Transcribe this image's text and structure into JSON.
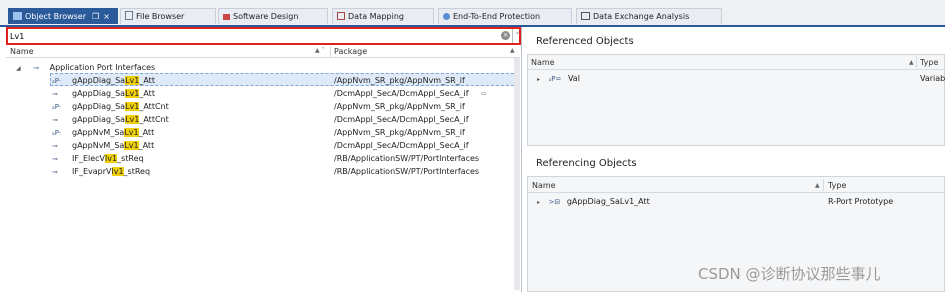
{
  "tabs": [
    {
      "label": "Object Browser",
      "active": true,
      "icon": "object-browser-icon"
    },
    {
      "label": "File Browser",
      "active": false,
      "icon": "file-icon"
    },
    {
      "label": "Software Design",
      "active": false,
      "icon": "software-design-icon"
    },
    {
      "label": "Data Mapping",
      "active": false,
      "icon": "data-mapping-icon"
    },
    {
      "label": "End-To-End Protection",
      "active": false,
      "icon": "protection-icon"
    },
    {
      "label": "Data Exchange Analysis",
      "active": false,
      "icon": "analysis-icon"
    }
  ],
  "tab_controls": {
    "pin": "❒",
    "close": "×"
  },
  "search": {
    "value": "Lv1",
    "clear": "×",
    "dropdown": "˅"
  },
  "left": {
    "col_name": "Name",
    "col_package": "Package",
    "root": "Application Port Interfaces",
    "rows": [
      {
        "pre": "gAppDiag_Sa",
        "hl": "Lv1",
        "post": "_Att",
        "package": "/AppNvm_SR_pkg/AppNvm_SR_if",
        "selected": true
      },
      {
        "pre": "gAppDiag_Sa",
        "hl": "Lv1",
        "post": "_Att",
        "package": "/DcmAppl_SecA/DcmAppl_SecA_if",
        "selected": false
      },
      {
        "pre": "gAppDiag_Sa",
        "hl": "Lv1",
        "post": "_AttCnt",
        "package": "/AppNvm_SR_pkg/AppNvm_SR_if",
        "selected": false
      },
      {
        "pre": "gAppDiag_Sa",
        "hl": "Lv1",
        "post": "_AttCnt",
        "package": "/DcmAppl_SecA/DcmAppl_SecA_if",
        "selected": false
      },
      {
        "pre": "gAppNvM_Sa",
        "hl": "Lv1",
        "post": "_Att",
        "package": "/AppNvm_SR_pkg/AppNvm_SR_if",
        "selected": false
      },
      {
        "pre": "gAppNvM_Sa",
        "hl": "Lv1",
        "post": "_Att",
        "package": "/DcmAppl_SecA/DcmAppl_SecA_if",
        "selected": false
      },
      {
        "pre": "IF_ElecV",
        "hl": "lv1",
        "post": "_stReq",
        "package": "/RB/ApplicationSW/PT/PortInterfaces",
        "selected": false
      },
      {
        "pre": "IF_EvaprV",
        "hl": "lv1",
        "post": "_stReq",
        "package": "/RB/ApplicationSW/PT/PortInterfaces",
        "selected": false
      }
    ]
  },
  "referenced": {
    "title": "Referenced Objects",
    "col_name": "Name",
    "col_type": "Type",
    "rows": [
      {
        "name": "Val",
        "type": "Variabl"
      }
    ]
  },
  "referencing": {
    "title": "Referencing Objects",
    "col_name": "Name",
    "col_type": "Type",
    "rows": [
      {
        "name": "gAppDiag_SaLv1_Att",
        "type": "R-Port Prototype"
      }
    ]
  },
  "watermark": "CSDN @诊断协议那些事儿",
  "colors": {
    "accent": "#2a5a9a",
    "highlight": "#f0cf0c",
    "search_border": "#e02020",
    "selection": "#dfeaf8"
  }
}
